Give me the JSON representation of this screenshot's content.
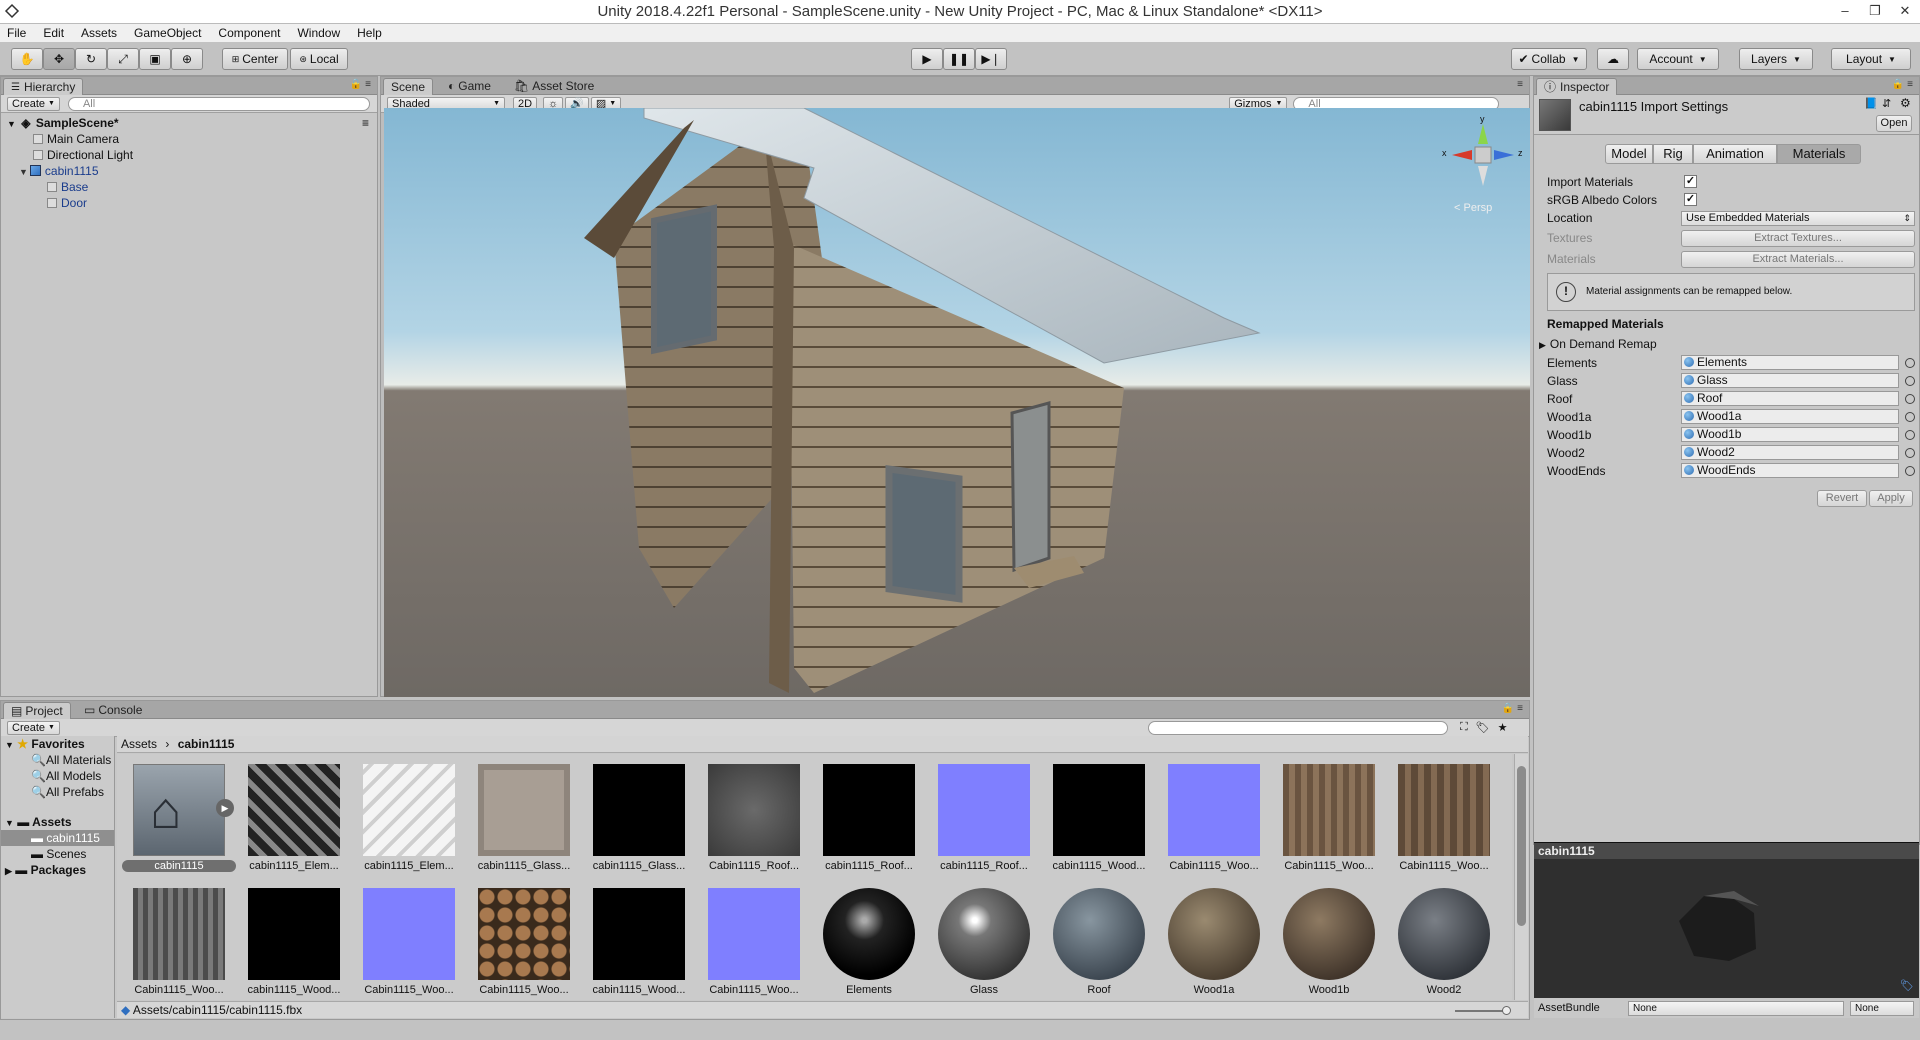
{
  "window": {
    "title": "Unity 2018.4.22f1 Personal - SampleScene.unity - New Unity Project - PC, Mac & Linux Standalone* <DX11>",
    "minimize": "–",
    "maximize": "❐",
    "close": "✕"
  },
  "menu": [
    "File",
    "Edit",
    "Assets",
    "GameObject",
    "Component",
    "Window",
    "Help"
  ],
  "toolbar": {
    "pivot": "Center",
    "space": "Local",
    "collab": "Collab",
    "account": "Account",
    "layers": "Layers",
    "layout": "Layout"
  },
  "hierarchy": {
    "tab": "Hierarchy",
    "create": "Create",
    "search_placeholder": "All",
    "scene": "SampleScene*",
    "items": [
      "Main Camera",
      "Directional Light",
      "cabin1115",
      "Base",
      "Door"
    ]
  },
  "scene": {
    "tabs": [
      "Scene",
      "Game",
      "Asset Store"
    ],
    "shading": "Shaded",
    "mode2d": "2D",
    "gizmos": "Gizmos",
    "search_placeholder": "All",
    "gizmo_x": "x",
    "gizmo_y": "y",
    "gizmo_z": "z",
    "persp": "Persp"
  },
  "inspector": {
    "tab": "Inspector",
    "asset_title": "cabin1115 Import Settings",
    "open": "Open",
    "tabs": [
      "Model",
      "Rig",
      "Animation",
      "Materials"
    ],
    "import_materials": "Import Materials",
    "srgb": "sRGB Albedo Colors",
    "location_label": "Location",
    "location_value": "Use Embedded Materials",
    "textures_label": "Textures",
    "extract_textures": "Extract Textures...",
    "materials_label": "Materials",
    "extract_materials": "Extract Materials...",
    "info": "Material assignments can be remapped below.",
    "remapped_header": "Remapped Materials",
    "on_demand": "On Demand Remap",
    "remaps": [
      {
        "label": "Elements",
        "value": "Elements"
      },
      {
        "label": "Glass",
        "value": "Glass"
      },
      {
        "label": "Roof",
        "value": "Roof"
      },
      {
        "label": "Wood1a",
        "value": "Wood1a"
      },
      {
        "label": "Wood1b",
        "value": "Wood1b"
      },
      {
        "label": "Wood2",
        "value": "Wood2"
      },
      {
        "label": "WoodEnds",
        "value": "WoodEnds"
      }
    ],
    "revert": "Revert",
    "apply": "Apply",
    "preview_title": "cabin1115",
    "assetbundle_label": "AssetBundle",
    "assetbundle_value": "None",
    "assetbundle_variant": "None"
  },
  "project": {
    "tabs": [
      "Project",
      "Console"
    ],
    "create": "Create",
    "favorites": "Favorites",
    "fav_items": [
      "All Materials",
      "All Models",
      "All Prefabs"
    ],
    "assets": "Assets",
    "asset_items": [
      "cabin1115",
      "Scenes"
    ],
    "packages": "Packages",
    "breadcrumb": [
      "Assets",
      "cabin1115"
    ],
    "status_path": "Assets/cabin1115/cabin1115.fbx",
    "row1": [
      "cabin1115",
      "cabin1115_Elem...",
      "cabin1115_Elem...",
      "cabin1115_Glass...",
      "cabin1115_Glass...",
      "Cabin1115_Roof...",
      "cabin1115_Roof...",
      "cabin1115_Roof...",
      "cabin1115_Wood...",
      "Cabin1115_Woo...",
      "Cabin1115_Woo...",
      "Cabin1115_Woo..."
    ],
    "row2": [
      "Cabin1115_Woo...",
      "cabin1115_Wood...",
      "Cabin1115_Woo...",
      "Cabin1115_Woo...",
      "cabin1115_Wood...",
      "Cabin1115_Woo...",
      "Elements",
      "Glass",
      "Roof",
      "Wood1a",
      "Wood1b",
      "Wood2"
    ]
  }
}
